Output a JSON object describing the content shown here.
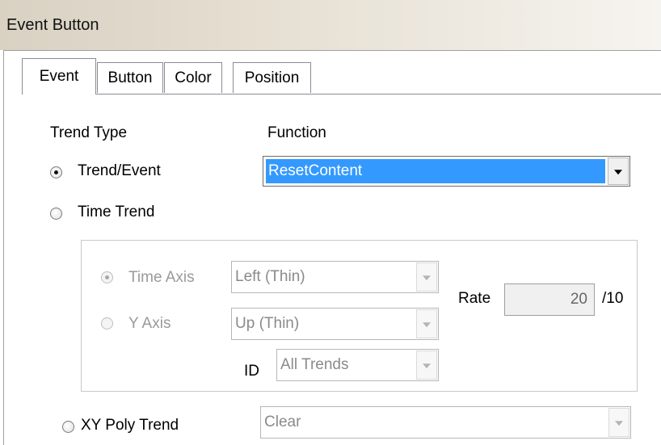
{
  "window": {
    "title": "Event Button"
  },
  "tabs": [
    {
      "label": "Event",
      "active": true
    },
    {
      "label": "Button",
      "active": false
    },
    {
      "label": "Color",
      "active": false
    },
    {
      "label": "Position",
      "active": false
    }
  ],
  "labels": {
    "trend_type": "Trend Type",
    "function": "Function"
  },
  "trend_types": {
    "trend_event": {
      "label": "Trend/Event",
      "checked": true
    },
    "time_trend": {
      "label": "Time Trend",
      "checked": false
    },
    "xy_poly_trend": {
      "label": "XY Poly Trend",
      "checked": false
    }
  },
  "function_combo": {
    "value": "ResetContent"
  },
  "time_trend_group": {
    "time_axis": {
      "label": "Time Axis",
      "checked": true,
      "value": "Left (Thin)"
    },
    "y_axis": {
      "label": "Y Axis",
      "checked": false,
      "value": "Up (Thin)"
    },
    "id": {
      "label": "ID",
      "value": "All Trends"
    },
    "rate": {
      "label": "Rate",
      "value": "20",
      "unit": "/10"
    }
  },
  "xy_poly_combo": {
    "value": "Clear"
  },
  "colors": {
    "selection": "#3399ff",
    "titlebar": "#d9d1c2"
  }
}
